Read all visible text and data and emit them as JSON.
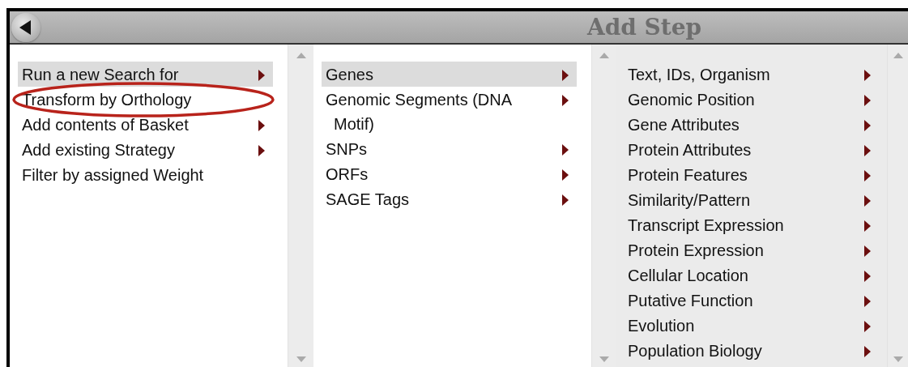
{
  "window": {
    "title": "Add Step"
  },
  "columns": [
    {
      "items": [
        {
          "lines": [
            "Run a new Search for"
          ],
          "selected": true,
          "submenu": true,
          "circled": false
        },
        {
          "lines": [
            "Transform by Orthology"
          ],
          "selected": false,
          "submenu": false,
          "circled": true
        },
        {
          "lines": [
            "Add contents of Basket"
          ],
          "selected": false,
          "submenu": true,
          "circled": false
        },
        {
          "lines": [
            "Add existing Strategy"
          ],
          "selected": false,
          "submenu": true,
          "circled": false
        },
        {
          "lines": [
            "Filter by assigned Weight"
          ],
          "selected": false,
          "submenu": false,
          "circled": false
        }
      ]
    },
    {
      "items": [
        {
          "lines": [
            "Genes"
          ],
          "selected": true,
          "submenu": true,
          "circled": false
        },
        {
          "lines": [
            "Genomic Segments (DNA",
            "Motif)"
          ],
          "selected": false,
          "submenu": true,
          "circled": false
        },
        {
          "lines": [
            "SNPs"
          ],
          "selected": false,
          "submenu": true,
          "circled": false
        },
        {
          "lines": [
            "ORFs"
          ],
          "selected": false,
          "submenu": true,
          "circled": false
        },
        {
          "lines": [
            "SAGE Tags"
          ],
          "selected": false,
          "submenu": true,
          "circled": false
        }
      ]
    },
    {
      "items": [
        {
          "lines": [
            "Text, IDs, Organism"
          ],
          "selected": false,
          "submenu": true,
          "circled": false
        },
        {
          "lines": [
            "Genomic Position"
          ],
          "selected": false,
          "submenu": true,
          "circled": false
        },
        {
          "lines": [
            "Gene Attributes"
          ],
          "selected": false,
          "submenu": true,
          "circled": false
        },
        {
          "lines": [
            "Protein Attributes"
          ],
          "selected": false,
          "submenu": true,
          "circled": false
        },
        {
          "lines": [
            "Protein Features"
          ],
          "selected": false,
          "submenu": true,
          "circled": false
        },
        {
          "lines": [
            "Similarity/Pattern"
          ],
          "selected": false,
          "submenu": true,
          "circled": false
        },
        {
          "lines": [
            "Transcript Expression"
          ],
          "selected": false,
          "submenu": true,
          "circled": false
        },
        {
          "lines": [
            "Protein Expression"
          ],
          "selected": false,
          "submenu": true,
          "circled": false
        },
        {
          "lines": [
            "Cellular Location"
          ],
          "selected": false,
          "submenu": true,
          "circled": false
        },
        {
          "lines": [
            "Putative Function"
          ],
          "selected": false,
          "submenu": true,
          "circled": false
        },
        {
          "lines": [
            "Evolution"
          ],
          "selected": false,
          "submenu": true,
          "circled": false
        },
        {
          "lines": [
            "Population Biology"
          ],
          "selected": false,
          "submenu": true,
          "circled": false
        }
      ]
    }
  ]
}
